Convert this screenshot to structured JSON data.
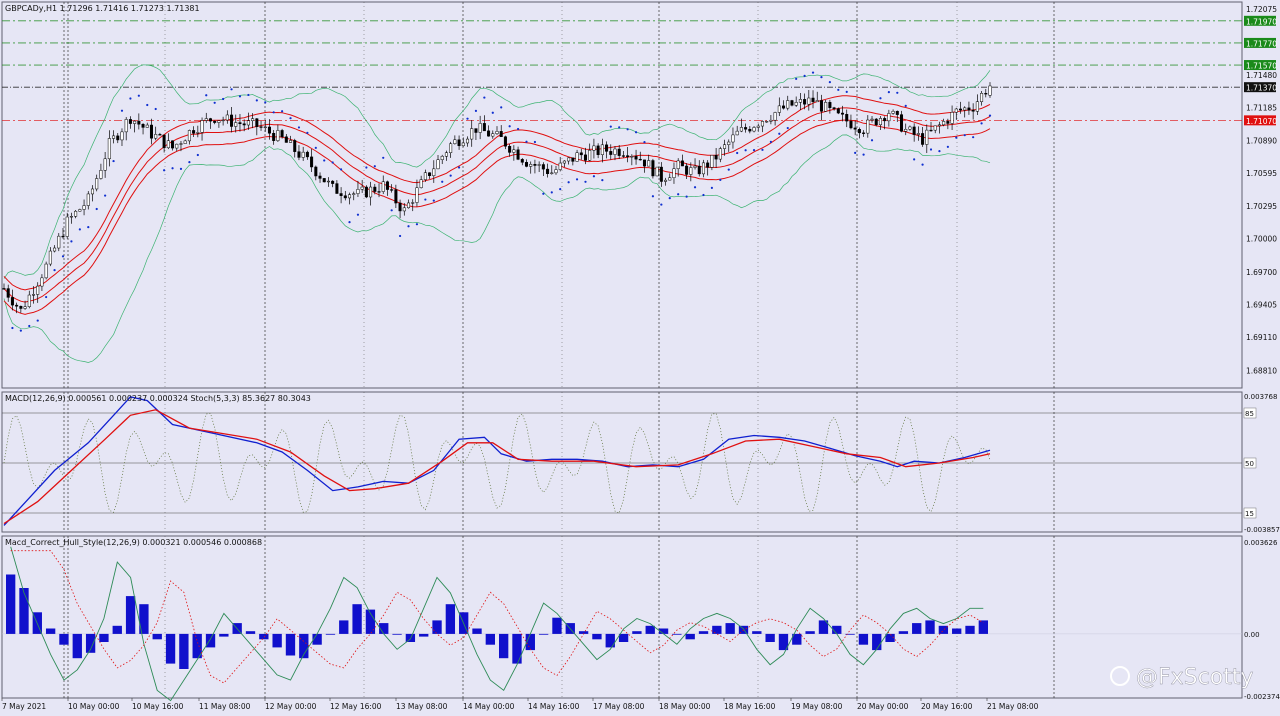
{
  "chart_data": [
    {
      "type": "candlestick",
      "title": "GBPCADy,H1  1.71296 1.71416 1.71273 1.71381",
      "symbol": "GBPCADy",
      "timeframe": "H1",
      "ohlc_last": [
        1.71296,
        1.71416,
        1.71273,
        1.71381
      ],
      "ylim": [
        1.6865,
        1.7214
      ],
      "price_tick_labels": [
        "1.72075",
        "1.71480",
        "1.71185",
        "1.70890",
        "1.70595",
        "1.70295",
        "1.70000",
        "1.69700",
        "1.69405",
        "1.69110",
        "1.68810"
      ],
      "level_labels": [
        {
          "text": "1.71970",
          "role": "resistance",
          "color": "#1a8a1a"
        },
        {
          "text": "1.71770",
          "role": "resistance",
          "color": "#1a8a1a"
        },
        {
          "text": "1.71570",
          "role": "resistance",
          "color": "#1a8a1a"
        },
        {
          "text": "1.71370",
          "role": "current",
          "color": "#111111"
        },
        {
          "text": "1.71070",
          "role": "support",
          "color": "#e01010"
        }
      ],
      "time_labels": [
        "7 May 2021",
        "10 May 00:00",
        "10 May 16:00",
        "11 May 08:00",
        "12 May 00:00",
        "12 May 16:00",
        "13 May 08:00",
        "14 May 00:00",
        "14 May 16:00",
        "17 May 08:00",
        "18 May 00:00",
        "18 May 16:00",
        "19 May 08:00",
        "20 May 00:00",
        "20 May 16:00",
        "21 May 08:00"
      ],
      "price_path": [
        [
          0,
          1.6955
        ],
        [
          4,
          1.6935
        ],
        [
          10,
          1.6975
        ],
        [
          15,
          1.7015
        ],
        [
          20,
          1.7035
        ],
        [
          25,
          1.7085
        ],
        [
          30,
          1.711
        ],
        [
          35,
          1.7095
        ],
        [
          40,
          1.7082
        ],
        [
          45,
          1.71
        ],
        [
          50,
          1.711
        ],
        [
          55,
          1.7105
        ],
        [
          60,
          1.7102
        ],
        [
          66,
          1.709
        ],
        [
          72,
          1.707
        ],
        [
          78,
          1.7045
        ],
        [
          84,
          1.704
        ],
        [
          90,
          1.7048
        ],
        [
          95,
          1.7025
        ],
        [
          100,
          1.7055
        ],
        [
          106,
          1.7085
        ],
        [
          112,
          1.71
        ],
        [
          118,
          1.709
        ],
        [
          124,
          1.707
        ],
        [
          130,
          1.706
        ],
        [
          136,
          1.7075
        ],
        [
          142,
          1.708
        ],
        [
          148,
          1.708
        ],
        [
          152,
          1.707
        ],
        [
          156,
          1.7055
        ],
        [
          160,
          1.7065
        ],
        [
          164,
          1.706
        ],
        [
          168,
          1.707
        ],
        [
          174,
          1.7095
        ],
        [
          180,
          1.7108
        ],
        [
          186,
          1.712
        ],
        [
          192,
          1.7125
        ],
        [
          198,
          1.711
        ],
        [
          204,
          1.71
        ],
        [
          210,
          1.7115
        ],
        [
          214,
          1.7098
        ],
        [
          218,
          1.709
        ],
        [
          222,
          1.7102
        ],
        [
          226,
          1.7115
        ],
        [
          230,
          1.712
        ],
        [
          234,
          1.714
        ]
      ],
      "series": [
        {
          "name": "Bollinger Bands (outer)",
          "color": "#3cb371"
        },
        {
          "name": "Envelopes",
          "color": "#e01010"
        },
        {
          "name": "Parabolic SAR",
          "color": "#1030d0"
        }
      ]
    },
    {
      "type": "line",
      "title": "MACD(12,26,9) 0.000561 0.000237 0.000324  Stoch(5,3,3) 85.3627 80.3043",
      "ylim": [
        -0.003857,
        0.003768
      ],
      "y_tick_labels": [
        "0.003768",
        "-0.003857"
      ],
      "stoch_levels": [
        "85",
        "50",
        "15"
      ],
      "series": [
        {
          "name": "MACD",
          "color": "#1020d0",
          "points": [
            [
              0,
              -0.0035
            ],
            [
              6,
              -0.002
            ],
            [
              12,
              -0.0005
            ],
            [
              20,
              0.001
            ],
            [
              26,
              0.0025
            ],
            [
              30,
              0.0035
            ],
            [
              34,
              0.0033
            ],
            [
              40,
              0.002
            ],
            [
              50,
              0.0015
            ],
            [
              60,
              0.001
            ],
            [
              66,
              0.0005
            ],
            [
              72,
              -0.0005
            ],
            [
              78,
              -0.0016
            ],
            [
              84,
              -0.0014
            ],
            [
              90,
              -0.0011
            ],
            [
              96,
              -0.0012
            ],
            [
              102,
              -0.0005
            ],
            [
              108,
              0.0012
            ],
            [
              114,
              0.0013
            ],
            [
              118,
              0.0004
            ],
            [
              124,
              0.0
            ],
            [
              130,
              0.0001
            ],
            [
              136,
              0.0001
            ],
            [
              142,
              0.0
            ],
            [
              148,
              -0.0003
            ],
            [
              154,
              -0.0002
            ],
            [
              160,
              -0.0003
            ],
            [
              166,
              0.0001
            ],
            [
              172,
              0.0012
            ],
            [
              178,
              0.0014
            ],
            [
              184,
              0.0013
            ],
            [
              190,
              0.0011
            ],
            [
              196,
              0.0007
            ],
            [
              202,
              0.0003
            ],
            [
              208,
              0.0
            ],
            [
              212,
              -0.0003
            ],
            [
              216,
              0.0
            ],
            [
              222,
              -0.0001
            ],
            [
              228,
              0.0002
            ],
            [
              234,
              0.0006
            ]
          ]
        },
        {
          "name": "Signal",
          "color": "#e01010",
          "points": [
            [
              0,
              -0.0034
            ],
            [
              8,
              -0.0022
            ],
            [
              16,
              -0.0005
            ],
            [
              24,
              0.0012
            ],
            [
              30,
              0.0025
            ],
            [
              36,
              0.0028
            ],
            [
              44,
              0.0018
            ],
            [
              52,
              0.0015
            ],
            [
              60,
              0.0012
            ],
            [
              68,
              0.0005
            ],
            [
              76,
              -0.0008
            ],
            [
              82,
              -0.0016
            ],
            [
              88,
              -0.0015
            ],
            [
              96,
              -0.0012
            ],
            [
              104,
              0.0
            ],
            [
              110,
              0.001
            ],
            [
              116,
              0.001
            ],
            [
              122,
              0.0001
            ],
            [
              130,
              0.0
            ],
            [
              140,
              0.0
            ],
            [
              150,
              -0.0003
            ],
            [
              160,
              -0.0002
            ],
            [
              168,
              0.0004
            ],
            [
              176,
              0.0011
            ],
            [
              184,
              0.0012
            ],
            [
              192,
              0.0008
            ],
            [
              200,
              0.0004
            ],
            [
              208,
              0.0002
            ],
            [
              214,
              -0.0003
            ],
            [
              222,
              -0.0001
            ],
            [
              230,
              0.0002
            ],
            [
              234,
              0.0004
            ]
          ]
        },
        {
          "name": "Stoch",
          "color": "#556b2f",
          "style": "dotted"
        }
      ]
    },
    {
      "type": "bar",
      "title": "Macd_Correct_Hull_Style(12,26,9) 0.000321 0.000546 0.000868",
      "ylim": [
        -0.002374,
        0.003626
      ],
      "y_tick_labels": [
        "0.003626",
        "0.00",
        "-0.002374"
      ],
      "series": [
        {
          "name": "Histogram",
          "color": "#1010cc",
          "values": [
            0.0022,
            0.0017,
            0.0008,
            0.0002,
            -0.0004,
            -0.0009,
            -0.0007,
            -0.0003,
            0.0003,
            0.0014,
            0.0011,
            -0.0002,
            -0.0011,
            -0.0013,
            -0.0009,
            -0.0005,
            -0.0001,
            0.0004,
            0.0001,
            -0.0002,
            -0.0005,
            -0.0008,
            -0.0009,
            -0.0004,
            0.0,
            0.0005,
            0.0011,
            0.0009,
            0.0004,
            0.0,
            -0.0003,
            -0.0001,
            0.0005,
            0.0011,
            0.0008,
            0.0002,
            -0.0004,
            -0.0009,
            -0.0011,
            -0.0006,
            0.0,
            0.0006,
            0.0004,
            0.0001,
            -0.0002,
            -0.0005,
            -0.0003,
            0.0001,
            0.0003,
            0.0002,
            0.0,
            -0.0002,
            0.0001,
            0.0003,
            0.0004,
            0.0003,
            0.0001,
            -0.0003,
            -0.0006,
            -0.0004,
            0.0001,
            0.0005,
            0.0003,
            0.0,
            -0.0004,
            -0.0006,
            -0.0003,
            0.0001,
            0.0004,
            0.0005,
            0.0003,
            0.0002,
            0.0003,
            0.0005
          ]
        },
        {
          "name": "Hull line",
          "color": "#2e8b57"
        },
        {
          "name": "Signal (dotted)",
          "color": "#e01010",
          "style": "dotted"
        }
      ]
    }
  ],
  "watermark": "@FxScotty"
}
